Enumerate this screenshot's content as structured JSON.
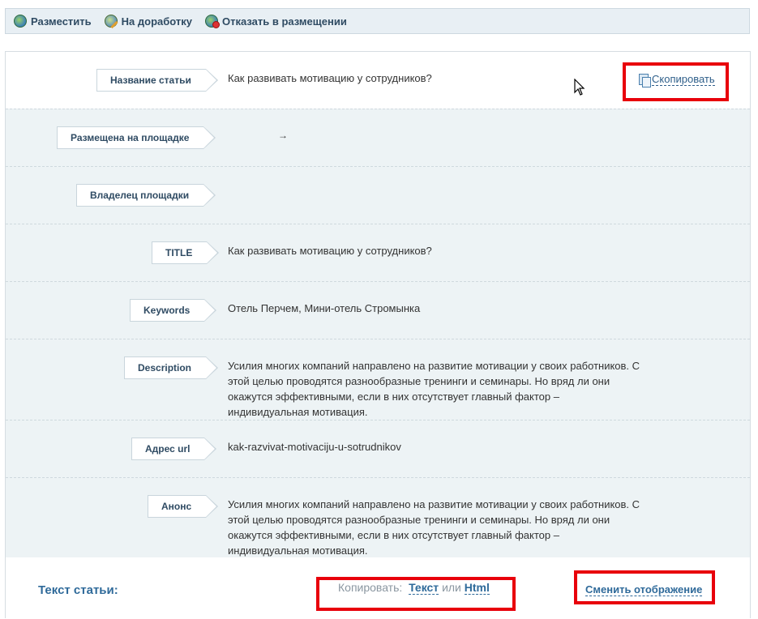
{
  "toolbar": {
    "items": [
      {
        "label": "Разместить",
        "icon": "globe-publish-icon"
      },
      {
        "label": "На доработку",
        "icon": "globe-edit-icon"
      },
      {
        "label": "Отказать в размещении",
        "icon": "globe-reject-icon"
      }
    ]
  },
  "copy_link": {
    "label": "Скопировать",
    "icon": "copy-documents-icon"
  },
  "fields": [
    {
      "label": "Название статьи",
      "value": "Как развивать мотивацию у сотрудников?"
    },
    {
      "label": "Размещена на площадке",
      "value": "→"
    },
    {
      "label": "Владелец площадки",
      "value": ""
    },
    {
      "label": "TITLE",
      "value": "Как развивать мотивацию у сотрудников?"
    },
    {
      "label": "Keywords",
      "value": "Отель Перчем, Мини-отель Стромынка"
    },
    {
      "label": "Description",
      "value": "Усилия многих компаний направлено на развитие мотивации у своих работников. С этой целью проводятся разнообразные тренинги и семинары. Но вряд ли они окажутся эффективными, если в них отсутствует главный фактор – индивидуальная мотивация."
    },
    {
      "label": "Адрес url",
      "value": "kak-razvivat-motivaciju-u-sotrudnikov"
    },
    {
      "label": "Анонс",
      "value": "Усилия многих компаний направлено на развитие мотивации у своих работников. С этой целью проводятся разнообразные тренинги и семинары. Но вряд ли они окажутся эффективными, если в них отсутствует главный фактор – индивидуальная мотивация."
    }
  ],
  "footer": {
    "article_text_label": "Текст статьи:",
    "copy_prefix": "Копировать:",
    "copy_text": "Текст",
    "copy_or": "или",
    "copy_html": "Html",
    "switch_view": "Сменить отображение"
  },
  "colors": {
    "highlight": "#e8000b",
    "link": "#2f6a9a",
    "row_background": "#edf3f5"
  }
}
